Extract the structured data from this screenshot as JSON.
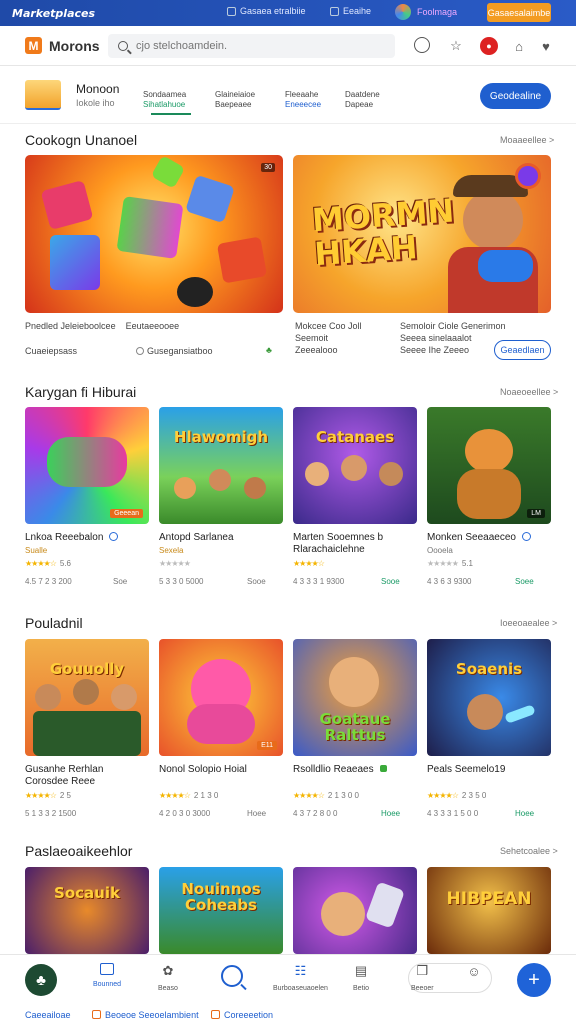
{
  "topbar": {
    "logo": "Marketplaces",
    "link1": "Gasaea etralbiie",
    "link2": "Eeaihe",
    "user": "Foolmaga",
    "button": "Gasaesalaimbe"
  },
  "header": {
    "brand": "Morons",
    "search_placeholder": "cjo stelchoamdein."
  },
  "profile": {
    "name": "Monoon",
    "sub": "Iokole iho",
    "tabs": [
      {
        "top": "Sondaamea",
        "bottom": "Sihatlahuoe"
      },
      {
        "top": "Glaineiaioe",
        "bottom": "Baepeaee"
      },
      {
        "top": "Fleeaahe",
        "bottom": "Eneeecee"
      },
      {
        "top": "Daatdene",
        "bottom": "Dapeae"
      }
    ],
    "follow": "Geodealine"
  },
  "sections": [
    {
      "title": "Cookogn Unanoel",
      "more": "Moaaeellee >"
    },
    {
      "title": "Karygan fi Hiburai",
      "more": "Noaeoeellee >"
    },
    {
      "title": "Pouladnil",
      "more": "Ioeeoaealee >"
    },
    {
      "title": "Paslaeoaikeehlor",
      "more": "Sehetcoalee >"
    }
  ],
  "banners": [
    {
      "tag": "30",
      "cap1": "Pnedled Jeleieboolcee",
      "cap2": "Eeutaeeooee",
      "meta1": "Cuaeiepsass",
      "meta2": "Gusegansiatboo"
    },
    {
      "title": "MORMN HKAH",
      "cap1": "Mokcee Coo Joll",
      "cap2": "Seemoit",
      "meta1": "Zeeealooo",
      "cap3": "Semoloir Ciole Generimon",
      "cap4": "Seeea sinelaaalot",
      "meta2": "Seeee Ihe Zeeeo",
      "install": "Geaedlaen"
    }
  ],
  "row1": [
    {
      "name": "Lnkoa Reeebalon",
      "sub": "Sualle",
      "rating": "5.6",
      "meta": "4.5 7 2 3 200",
      "dl": "Soe",
      "tag": "Geeean",
      "title": ""
    },
    {
      "name": "Antopd Sarlanea",
      "sub": "Sexela",
      "rating": "",
      "meta": "5 3 3 0 5000",
      "dl": "Sooe",
      "tag": "",
      "title": "Hlawomigh"
    },
    {
      "name": "Marten Sooemnes b",
      "name2": "Rlarachaiclehne",
      "sub": "",
      "rating": "",
      "meta": "4 3 3 3 1 9300",
      "dl": "Sooe",
      "tag": "",
      "title": "Catanaes"
    },
    {
      "name": "Monken Seeaaeceo",
      "sub": "Oooela",
      "rating": "5.1",
      "meta": "4 3 6 3 9300",
      "dl": "Soee",
      "tag": "LM",
      "title": ""
    }
  ],
  "row2": [
    {
      "name": "Gusanhe Rerhlan",
      "name2": "Corosdee Reee",
      "rating": "2 5",
      "meta": "5 1 3 3 2 1500",
      "dl": "Heeo",
      "title": "Gouuolly"
    },
    {
      "name": "Nonol Solopio Hoial",
      "rating": "2 1 3 0",
      "meta": "4 2 0 3 0 3000",
      "dl": "Hoee",
      "tag": "E11",
      "title": ""
    },
    {
      "name": "Rsolldlio Reaeaes",
      "rating": "2 1 3 0 0",
      "meta": "4 3 7 2 8 0 0",
      "dl": "Hoee",
      "title": "Goataue Ralttus"
    },
    {
      "name": "Peals Seemelo19",
      "rating": "2 3 5 0",
      "meta": "4 3 3 3 1 5 0 0",
      "dl": "Hoee",
      "title": "Soaenis"
    }
  ],
  "row3": [
    {
      "title": "Socauik"
    },
    {
      "title": "Nouinnos Coheabs"
    },
    {
      "title": ""
    },
    {
      "title": "HIBPEAN"
    }
  ],
  "bottom_nav": [
    {
      "label": "Bounned"
    },
    {
      "label": "Beaso"
    },
    {
      "label": "Burboaseuaoelen"
    },
    {
      "label": "Betio"
    },
    {
      "label": "Beeoer"
    }
  ],
  "footer": {
    "link1": "Caeeailoae",
    "link2": "Beoeoe Seeoelambient",
    "link3": "Coreeeetion"
  }
}
